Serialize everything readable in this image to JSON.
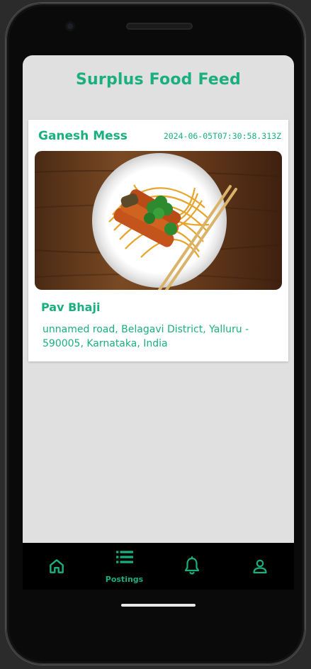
{
  "header": {
    "title": "Surplus Food Feed"
  },
  "feed": {
    "items": [
      {
        "provider": "Ganesh Mess",
        "timestamp": "2024-06-05T07:30:58.313Z",
        "food_name": "Pav Bhaji",
        "address": "unnamed road, Belagavi District, Yalluru - 590005, Karnataka, India"
      }
    ]
  },
  "bottom_nav": {
    "items": [
      {
        "icon": "home-icon",
        "label": ""
      },
      {
        "icon": "list-icon",
        "label": "Postings"
      },
      {
        "icon": "bell-icon",
        "label": ""
      },
      {
        "icon": "person-icon",
        "label": ""
      }
    ]
  },
  "colors": {
    "accent": "#1aaf7f",
    "screen_bg": "#e0e0e0",
    "card_bg": "#ffffff",
    "nav_bg": "#000000"
  }
}
